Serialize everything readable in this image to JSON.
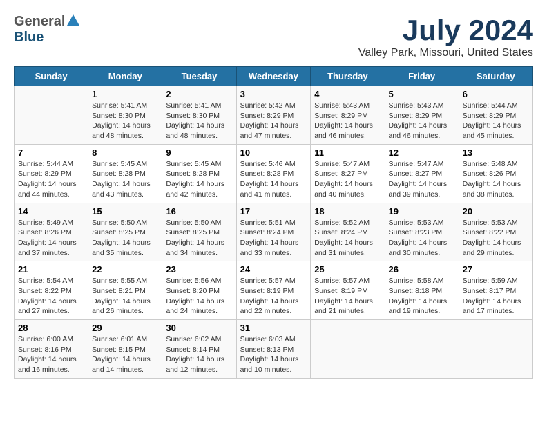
{
  "header": {
    "logo_general": "General",
    "logo_blue": "Blue",
    "title": "July 2024",
    "subtitle": "Valley Park, Missouri, United States"
  },
  "days_of_week": [
    "Sunday",
    "Monday",
    "Tuesday",
    "Wednesday",
    "Thursday",
    "Friday",
    "Saturday"
  ],
  "weeks": [
    [
      {
        "day": "",
        "info": ""
      },
      {
        "day": "1",
        "info": "Sunrise: 5:41 AM\nSunset: 8:30 PM\nDaylight: 14 hours and 48 minutes."
      },
      {
        "day": "2",
        "info": "Sunrise: 5:41 AM\nSunset: 8:30 PM\nDaylight: 14 hours and 48 minutes."
      },
      {
        "day": "3",
        "info": "Sunrise: 5:42 AM\nSunset: 8:29 PM\nDaylight: 14 hours and 47 minutes."
      },
      {
        "day": "4",
        "info": "Sunrise: 5:43 AM\nSunset: 8:29 PM\nDaylight: 14 hours and 46 minutes."
      },
      {
        "day": "5",
        "info": "Sunrise: 5:43 AM\nSunset: 8:29 PM\nDaylight: 14 hours and 46 minutes."
      },
      {
        "day": "6",
        "info": "Sunrise: 5:44 AM\nSunset: 8:29 PM\nDaylight: 14 hours and 45 minutes."
      }
    ],
    [
      {
        "day": "7",
        "info": "Sunrise: 5:44 AM\nSunset: 8:29 PM\nDaylight: 14 hours and 44 minutes."
      },
      {
        "day": "8",
        "info": "Sunrise: 5:45 AM\nSunset: 8:28 PM\nDaylight: 14 hours and 43 minutes."
      },
      {
        "day": "9",
        "info": "Sunrise: 5:45 AM\nSunset: 8:28 PM\nDaylight: 14 hours and 42 minutes."
      },
      {
        "day": "10",
        "info": "Sunrise: 5:46 AM\nSunset: 8:28 PM\nDaylight: 14 hours and 41 minutes."
      },
      {
        "day": "11",
        "info": "Sunrise: 5:47 AM\nSunset: 8:27 PM\nDaylight: 14 hours and 40 minutes."
      },
      {
        "day": "12",
        "info": "Sunrise: 5:47 AM\nSunset: 8:27 PM\nDaylight: 14 hours and 39 minutes."
      },
      {
        "day": "13",
        "info": "Sunrise: 5:48 AM\nSunset: 8:26 PM\nDaylight: 14 hours and 38 minutes."
      }
    ],
    [
      {
        "day": "14",
        "info": "Sunrise: 5:49 AM\nSunset: 8:26 PM\nDaylight: 14 hours and 37 minutes."
      },
      {
        "day": "15",
        "info": "Sunrise: 5:50 AM\nSunset: 8:25 PM\nDaylight: 14 hours and 35 minutes."
      },
      {
        "day": "16",
        "info": "Sunrise: 5:50 AM\nSunset: 8:25 PM\nDaylight: 14 hours and 34 minutes."
      },
      {
        "day": "17",
        "info": "Sunrise: 5:51 AM\nSunset: 8:24 PM\nDaylight: 14 hours and 33 minutes."
      },
      {
        "day": "18",
        "info": "Sunrise: 5:52 AM\nSunset: 8:24 PM\nDaylight: 14 hours and 31 minutes."
      },
      {
        "day": "19",
        "info": "Sunrise: 5:53 AM\nSunset: 8:23 PM\nDaylight: 14 hours and 30 minutes."
      },
      {
        "day": "20",
        "info": "Sunrise: 5:53 AM\nSunset: 8:22 PM\nDaylight: 14 hours and 29 minutes."
      }
    ],
    [
      {
        "day": "21",
        "info": "Sunrise: 5:54 AM\nSunset: 8:22 PM\nDaylight: 14 hours and 27 minutes."
      },
      {
        "day": "22",
        "info": "Sunrise: 5:55 AM\nSunset: 8:21 PM\nDaylight: 14 hours and 26 minutes."
      },
      {
        "day": "23",
        "info": "Sunrise: 5:56 AM\nSunset: 8:20 PM\nDaylight: 14 hours and 24 minutes."
      },
      {
        "day": "24",
        "info": "Sunrise: 5:57 AM\nSunset: 8:19 PM\nDaylight: 14 hours and 22 minutes."
      },
      {
        "day": "25",
        "info": "Sunrise: 5:57 AM\nSunset: 8:19 PM\nDaylight: 14 hours and 21 minutes."
      },
      {
        "day": "26",
        "info": "Sunrise: 5:58 AM\nSunset: 8:18 PM\nDaylight: 14 hours and 19 minutes."
      },
      {
        "day": "27",
        "info": "Sunrise: 5:59 AM\nSunset: 8:17 PM\nDaylight: 14 hours and 17 minutes."
      }
    ],
    [
      {
        "day": "28",
        "info": "Sunrise: 6:00 AM\nSunset: 8:16 PM\nDaylight: 14 hours and 16 minutes."
      },
      {
        "day": "29",
        "info": "Sunrise: 6:01 AM\nSunset: 8:15 PM\nDaylight: 14 hours and 14 minutes."
      },
      {
        "day": "30",
        "info": "Sunrise: 6:02 AM\nSunset: 8:14 PM\nDaylight: 14 hours and 12 minutes."
      },
      {
        "day": "31",
        "info": "Sunrise: 6:03 AM\nSunset: 8:13 PM\nDaylight: 14 hours and 10 minutes."
      },
      {
        "day": "",
        "info": ""
      },
      {
        "day": "",
        "info": ""
      },
      {
        "day": "",
        "info": ""
      }
    ]
  ]
}
